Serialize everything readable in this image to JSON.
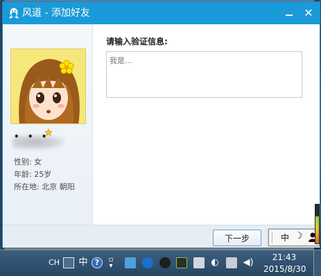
{
  "window": {
    "title": "风道 - 添加好友",
    "minimize_label": "_",
    "close_label": "✕"
  },
  "profile": {
    "nickname_masked": "• • •",
    "gender": "性别: 女",
    "age": "年龄: 25岁",
    "location": "所在地: 北京  朝阳"
  },
  "form": {
    "prompt": "请输入验证信息:",
    "message_placeholder": "我是..."
  },
  "footer": {
    "next_label": "下一步"
  },
  "ime": {
    "mode": "中",
    "moon": "☽"
  },
  "taskbar": {
    "lang": "CH",
    "ime_mode": "中",
    "help": "?",
    "time": "21:43",
    "date": "2015/8/30"
  },
  "icons": [
    "qq-penguin-icon",
    "star-icon",
    "avatar-cartoon-girl"
  ],
  "colors": {
    "titlebar": "#1a9ad9",
    "left_panel": "#eef3f8",
    "button_border": "#6a9ed0"
  }
}
